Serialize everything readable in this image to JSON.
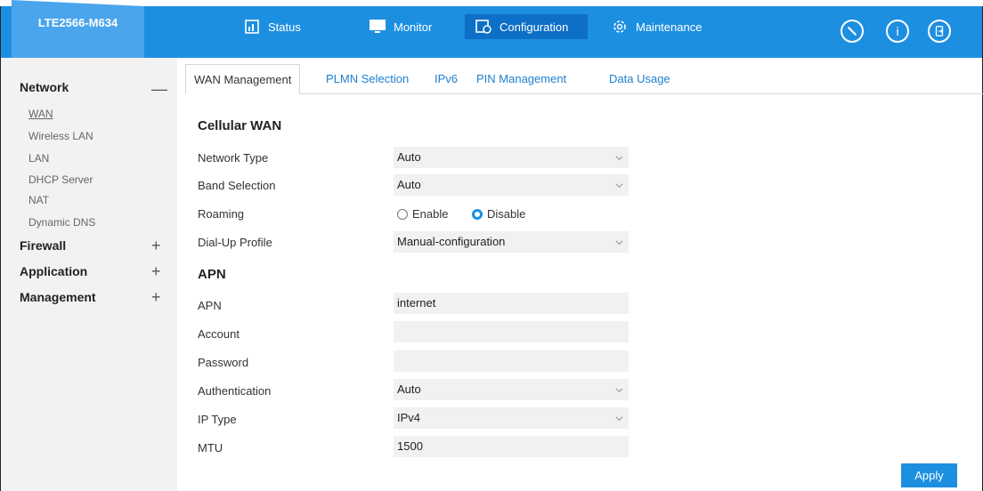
{
  "header": {
    "model": "LTE2566-M634",
    "nav": [
      {
        "label": "Status",
        "icon": "status-icon"
      },
      {
        "label": "Monitor",
        "icon": "monitor-icon"
      },
      {
        "label": "Configuration",
        "icon": "configuration-icon",
        "active": true
      },
      {
        "label": "Maintenance",
        "icon": "gear-icon"
      }
    ],
    "right_icons": [
      "wand-icon",
      "info-icon",
      "logout-icon"
    ],
    "info_glyph": "i"
  },
  "sidebar": {
    "groups": [
      {
        "label": "Network",
        "toggle": "—",
        "items": [
          "WAN",
          "Wireless LAN",
          "LAN",
          "DHCP Server",
          "NAT",
          "Dynamic DNS"
        ]
      },
      {
        "label": "Firewall",
        "toggle": "+"
      },
      {
        "label": "Application",
        "toggle": "+"
      },
      {
        "label": "Management",
        "toggle": "+"
      }
    ],
    "active_item": "WAN"
  },
  "tabs": [
    "WAN Management",
    "PLMN Selection",
    "IPv6",
    "PIN Management",
    "Data Usage"
  ],
  "form": {
    "cellular_title": "Cellular WAN",
    "network_type": {
      "label": "Network Type",
      "value": "Auto"
    },
    "band_selection": {
      "label": "Band Selection",
      "value": "Auto"
    },
    "roaming": {
      "label": "Roaming",
      "options": [
        "Enable",
        "Disable"
      ],
      "selected": "Disable"
    },
    "dialup_profile": {
      "label": "Dial-Up Profile",
      "value": "Manual-configuration"
    },
    "apn_title": "APN",
    "apn": {
      "label": "APN",
      "value": "internet"
    },
    "account": {
      "label": "Account",
      "value": ""
    },
    "password": {
      "label": "Password",
      "value": ""
    },
    "authentication": {
      "label": "Authentication",
      "value": "Auto"
    },
    "ip_type": {
      "label": "IP Type",
      "value": "IPv4"
    },
    "mtu": {
      "label": "MTU",
      "value": "1500"
    },
    "apply_label": "Apply"
  },
  "colors": {
    "brand": "#1d8fe1",
    "active_nav": "#0d6fc6",
    "model_tab": "#4aa5ec",
    "sidebar_bg": "#f2f2f2",
    "field_bg": "#f1f1f1",
    "tab_link": "#1d7fd0"
  }
}
